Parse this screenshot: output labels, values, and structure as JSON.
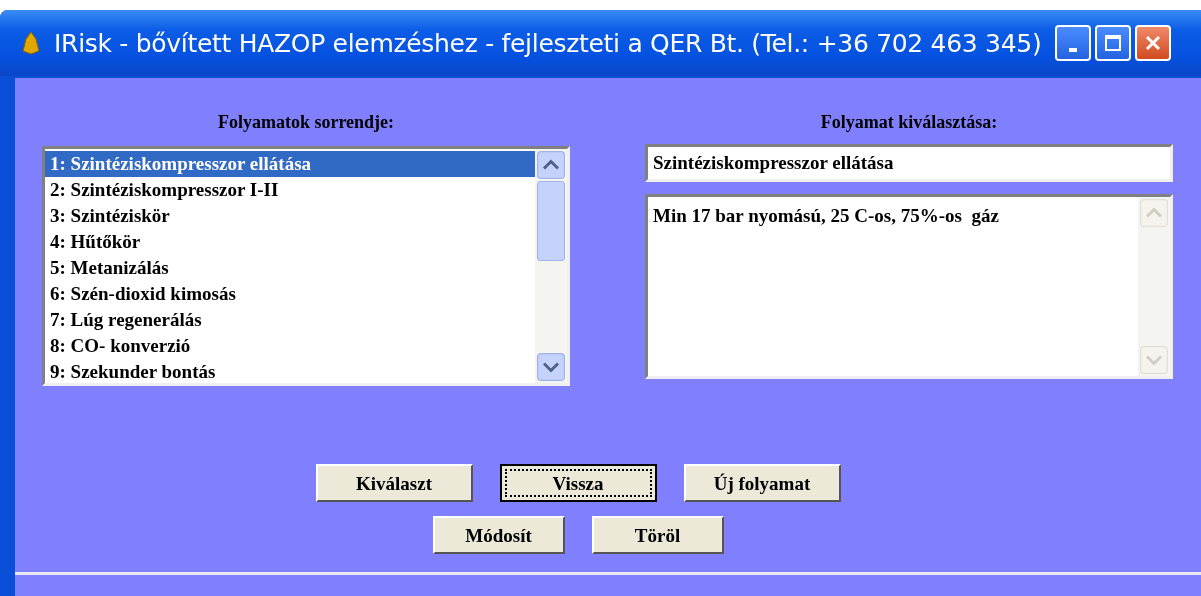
{
  "window": {
    "title": "IRisk - bővített HAZOP elemzéshez - fejleszteti a QER Bt. (Tel.: +36 702 463 345)"
  },
  "process_list": {
    "heading": "Folyamatok sorrendje:",
    "items": [
      {
        "label": "1: Szintéziskompresszor ellátása",
        "selected": true
      },
      {
        "label": "2: Szintéziskompresszor I-II",
        "selected": false
      },
      {
        "label": "3: Szintéziskör",
        "selected": false
      },
      {
        "label": "4: Hűtőkör",
        "selected": false
      },
      {
        "label": "5: Metanizálás",
        "selected": false
      },
      {
        "label": "6: Szén-dioxid kimosás",
        "selected": false
      },
      {
        "label": "7: Lúg regenerálás",
        "selected": false
      },
      {
        "label": "8: CO- konverzió",
        "selected": false
      },
      {
        "label": "9: Szekunder bontás",
        "selected": false
      }
    ]
  },
  "process_selection": {
    "heading": "Folyamat kiválasztása:",
    "name_value": "Szintéziskompresszor ellátása",
    "description_value": "Min 17 bar nyomású, 25 C-os, 75%-os  gáz"
  },
  "button_rows": [
    [
      {
        "label": "Kiválaszt",
        "focused": false
      },
      {
        "label": "Vissza",
        "focused": true
      },
      {
        "label": "Új folyamat",
        "focused": false
      }
    ],
    [
      {
        "label": "Módosít",
        "focused": false
      },
      {
        "label": "Töröl",
        "focused": false
      }
    ]
  ]
}
